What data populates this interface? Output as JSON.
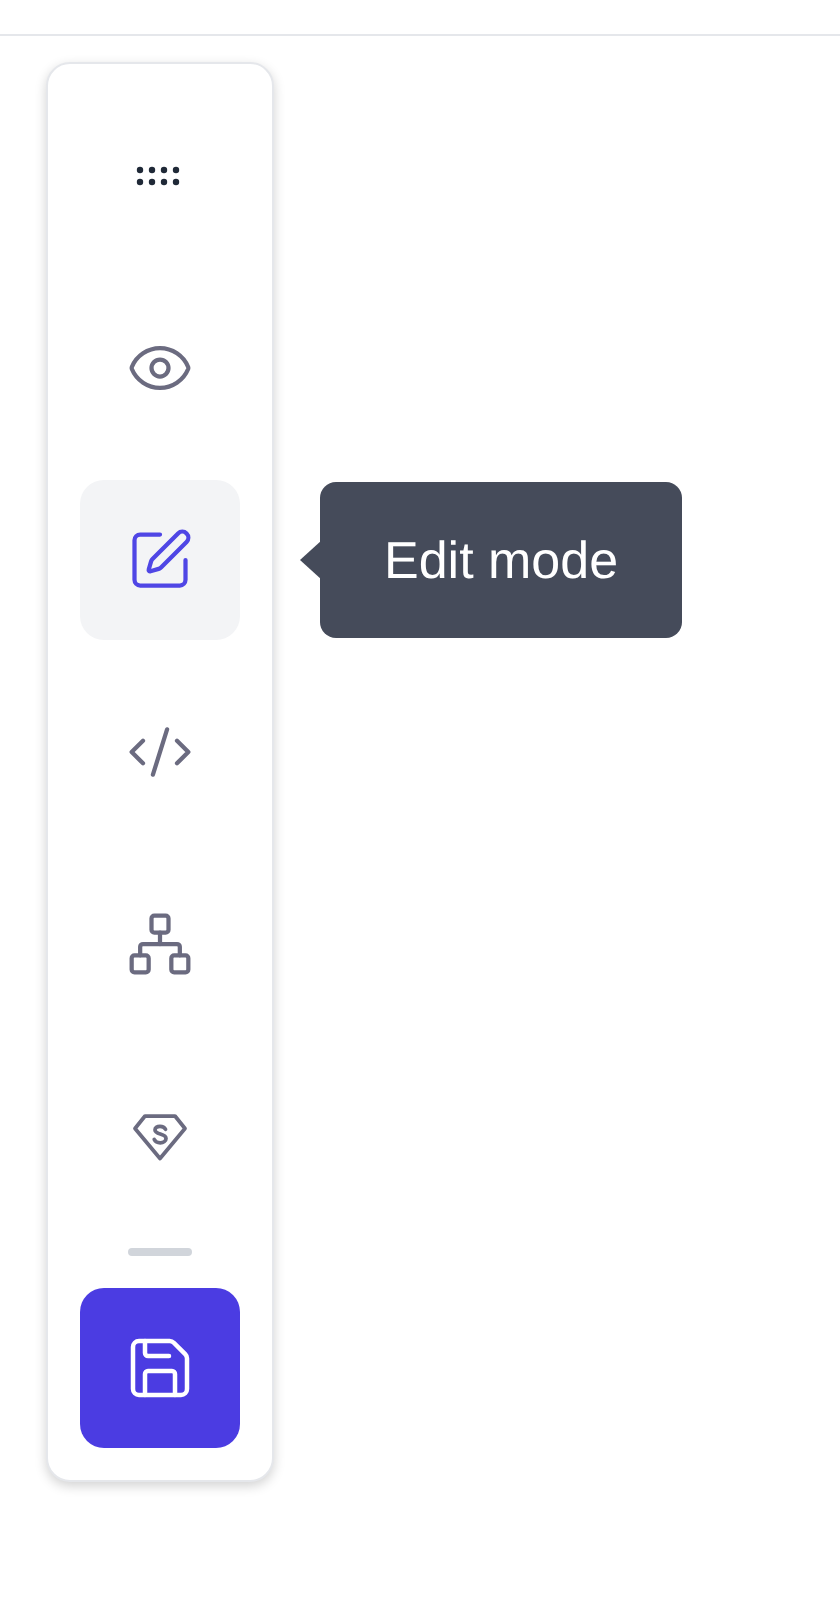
{
  "toolbar": {
    "items": [
      {
        "kind": "drag",
        "selected": false
      },
      {
        "kind": "preview",
        "selected": false
      },
      {
        "kind": "edit",
        "selected": true
      },
      {
        "kind": "code",
        "selected": false
      },
      {
        "kind": "structure",
        "selected": false
      },
      {
        "kind": "badge",
        "selected": false
      },
      {
        "kind": "divider"
      },
      {
        "kind": "save",
        "selected": false
      }
    ]
  },
  "tooltip": {
    "text": "Edit mode"
  }
}
